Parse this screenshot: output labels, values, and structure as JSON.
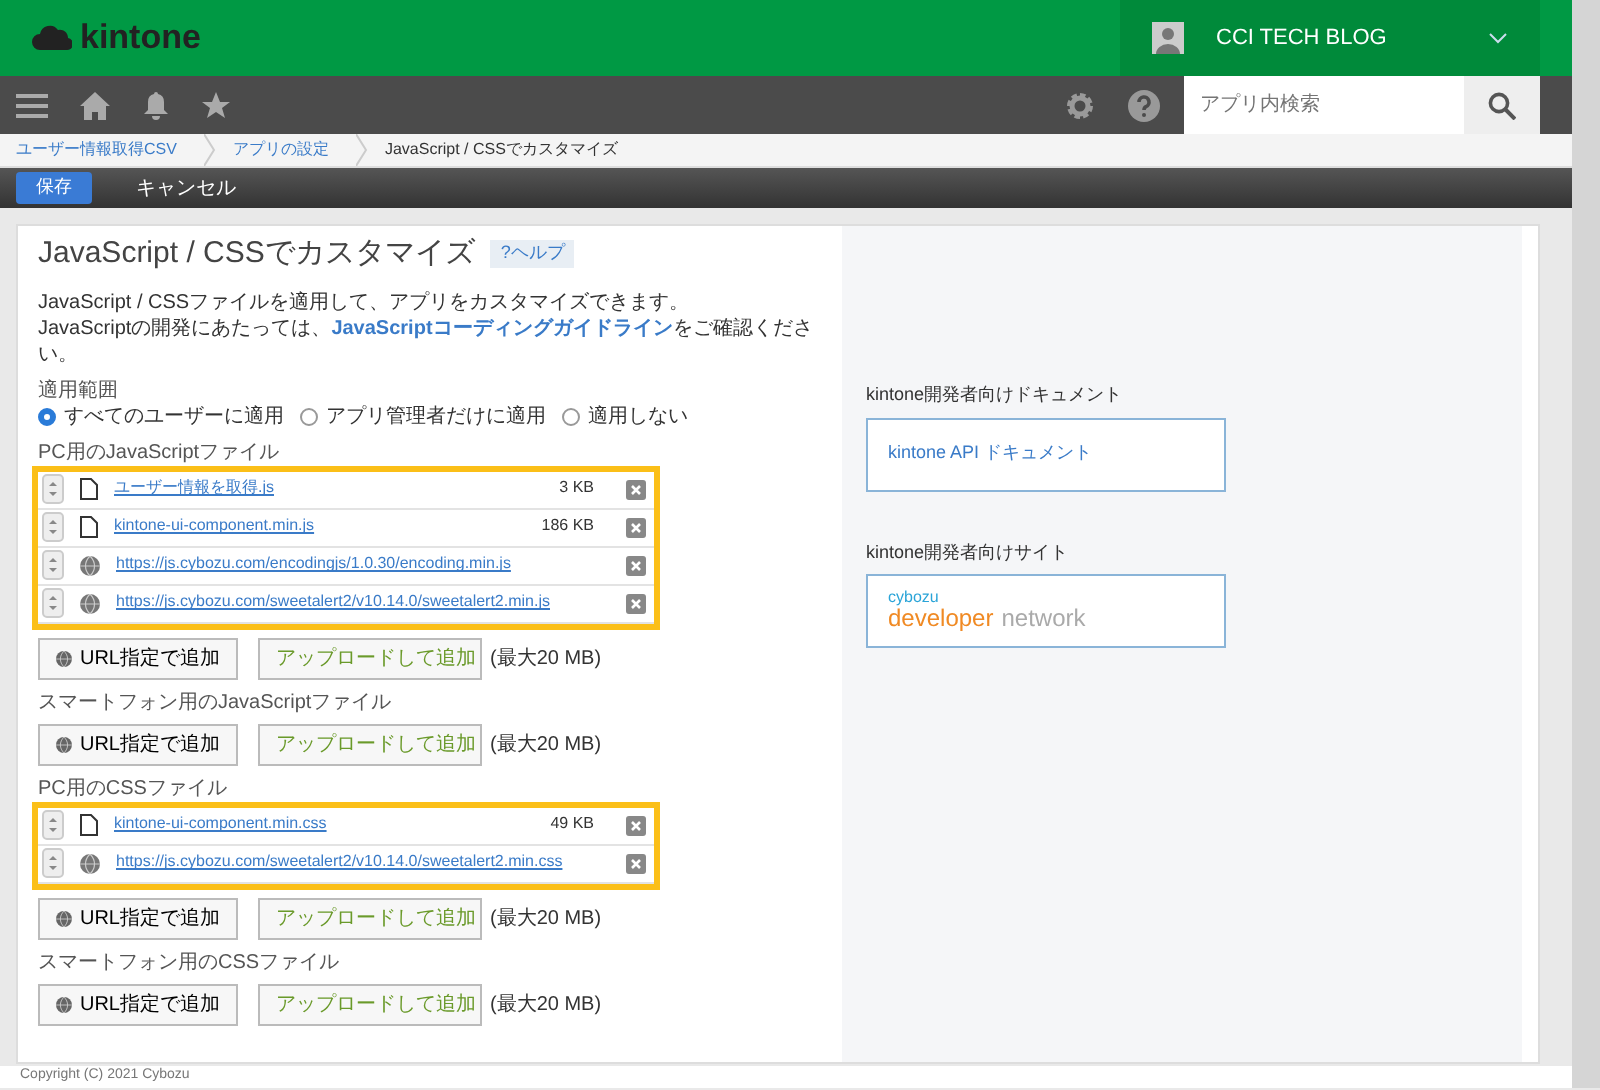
{
  "header": {
    "logo": "kintone",
    "user": "CCI TECH BLOG"
  },
  "toolbar": {
    "search_placeholder": "アプリ内検索"
  },
  "breadcrumbs": [
    "ユーザー情報取得CSV",
    "アプリの設定",
    "JavaScript / CSSでカスタマイズ"
  ],
  "actions": {
    "save": "保存",
    "cancel": "キャンセル"
  },
  "page": {
    "title": "JavaScript / CSSでカスタマイズ",
    "help": "?ヘルプ",
    "description": [
      "JavaScript / CSSファイルを適用して、アプリをカスタマイズできます。",
      {
        "before": "JavaScriptの開発にあたっては、",
        "link": "JavaScriptコーディングガイドライン",
        "after": "をご確認ください。"
      }
    ],
    "scope": {
      "label": "適用範囲",
      "options": [
        {
          "label": "すべてのユーザーに適用",
          "selected": true
        },
        {
          "label": "アプリ管理者だけに適用",
          "selected": false
        },
        {
          "label": "適用しない",
          "selected": false
        }
      ]
    },
    "sections": [
      {
        "title": "PC用のJavaScriptファイル",
        "highlighted": true,
        "files": [
          {
            "kind": "file",
            "name": "ユーザー情報を取得.js",
            "size": "3 KB"
          },
          {
            "kind": "file",
            "name": "kintone-ui-component.min.js",
            "size": "186 KB"
          },
          {
            "kind": "url",
            "name": "https://js.cybozu.com/encodingjs/1.0.30/encoding.min.js"
          },
          {
            "kind": "url",
            "name": "https://js.cybozu.com/sweetalert2/v10.14.0/sweetalert2.min.js"
          }
        ],
        "url_button": "URL指定で追加",
        "upload_button": "アップロードして追加",
        "limit": "(最大20 MB)"
      },
      {
        "title": "スマートフォン用のJavaScriptファイル",
        "url_button": "URL指定で追加",
        "upload_button": "アップロードして追加",
        "limit": "(最大20 MB)"
      },
      {
        "title": "PC用のCSSファイル",
        "highlighted": true,
        "files": [
          {
            "kind": "file",
            "name": "kintone-ui-component.min.css",
            "size": "49 KB"
          },
          {
            "kind": "url",
            "name": "https://js.cybozu.com/sweetalert2/v10.14.0/sweetalert2.min.css"
          }
        ],
        "url_button": "URL指定で追加",
        "upload_button": "アップロードして追加",
        "limit": "(最大20 MB)"
      },
      {
        "title": "スマートフォン用のCSSファイル",
        "url_button": "URL指定で追加",
        "upload_button": "アップロードして追加",
        "limit": "(最大20 MB)"
      }
    ],
    "side": {
      "docs_title": "kintone開発者向けドキュメント",
      "docs_link": "kintone API ドキュメント",
      "site_title": "kintone開発者向けサイト",
      "site_logo": {
        "top": "cybozu",
        "main": "developer",
        "rest": "network"
      }
    }
  },
  "footer": "Copyright (C) 2021 Cybozu"
}
